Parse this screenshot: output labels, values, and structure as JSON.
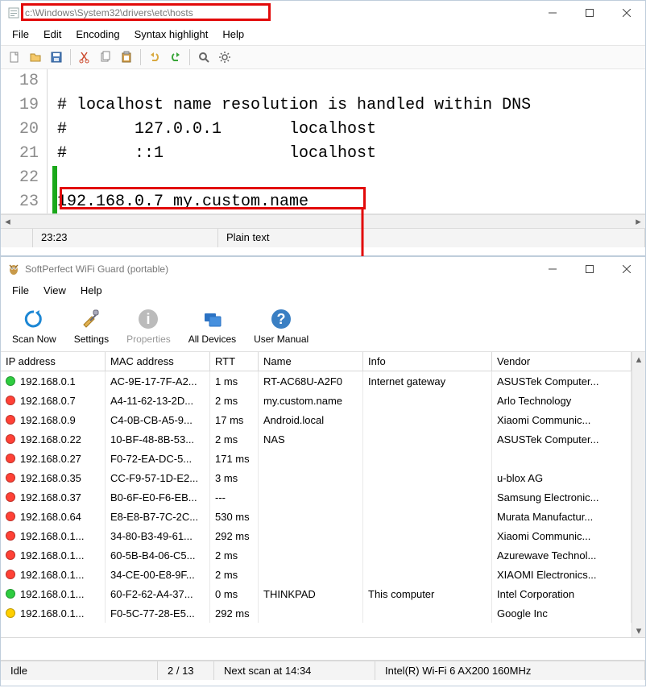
{
  "notepad": {
    "title": "c:\\Windows\\System32\\drivers\\etc\\hosts",
    "menu": [
      "File",
      "Edit",
      "Encoding",
      "Syntax highlight",
      "Help"
    ],
    "lines": [
      {
        "n": "18",
        "text": ""
      },
      {
        "n": "19",
        "text": "# localhost name resolution is handled within DNS"
      },
      {
        "n": "20",
        "text": "#       127.0.0.1       localhost"
      },
      {
        "n": "21",
        "text": "#       ::1             localhost"
      },
      {
        "n": "22",
        "text": ""
      },
      {
        "n": "23",
        "text": "192.168.0.7 my.custom.name"
      }
    ],
    "status": {
      "pos": "23:23",
      "mode": "Plain text"
    }
  },
  "wifiguard": {
    "title": "SoftPerfect WiFi Guard (portable)",
    "menu": [
      "File",
      "View",
      "Help"
    ],
    "toolbar": [
      "Scan Now",
      "Settings",
      "Properties",
      "All Devices",
      "User Manual"
    ],
    "columns": [
      "IP address",
      "MAC address",
      "RTT",
      "Name",
      "Info",
      "Vendor"
    ],
    "rows": [
      {
        "dot": "green",
        "ip": "192.168.0.1",
        "mac": "AC-9E-17-7F-A2...",
        "rtt": "1 ms",
        "name": "RT-AC68U-A2F0",
        "info": "Internet gateway",
        "vendor": "ASUSTek Computer..."
      },
      {
        "dot": "red",
        "ip": "192.168.0.7",
        "mac": "A4-11-62-13-2D...",
        "rtt": "2 ms",
        "name": "my.custom.name",
        "info": "",
        "vendor": "Arlo Technology"
      },
      {
        "dot": "red",
        "ip": "192.168.0.9",
        "mac": "C4-0B-CB-A5-9...",
        "rtt": "17 ms",
        "name": "Android.local",
        "info": "",
        "vendor": "Xiaomi Communic..."
      },
      {
        "dot": "red",
        "ip": "192.168.0.22",
        "mac": "10-BF-48-8B-53...",
        "rtt": "2 ms",
        "name": "NAS",
        "info": "",
        "vendor": "ASUSTek Computer..."
      },
      {
        "dot": "red",
        "ip": "192.168.0.27",
        "mac": "F0-72-EA-DC-5...",
        "rtt": "171 ms",
        "name": "",
        "info": "",
        "vendor": ""
      },
      {
        "dot": "red",
        "ip": "192.168.0.35",
        "mac": "CC-F9-57-1D-E2...",
        "rtt": "3 ms",
        "name": "",
        "info": "",
        "vendor": "u-blox AG"
      },
      {
        "dot": "red",
        "ip": "192.168.0.37",
        "mac": "B0-6F-E0-F6-EB...",
        "rtt": "---",
        "name": "",
        "info": "",
        "vendor": "Samsung Electronic..."
      },
      {
        "dot": "red",
        "ip": "192.168.0.64",
        "mac": "E8-E8-B7-7C-2C...",
        "rtt": "530 ms",
        "name": "",
        "info": "",
        "vendor": "Murata Manufactur..."
      },
      {
        "dot": "red",
        "ip": "192.168.0.1...",
        "mac": "34-80-B3-49-61...",
        "rtt": "292 ms",
        "name": "",
        "info": "",
        "vendor": "Xiaomi Communic..."
      },
      {
        "dot": "red",
        "ip": "192.168.0.1...",
        "mac": "60-5B-B4-06-C5...",
        "rtt": "2 ms",
        "name": "",
        "info": "",
        "vendor": "Azurewave Technol..."
      },
      {
        "dot": "red",
        "ip": "192.168.0.1...",
        "mac": "34-CE-00-E8-9F...",
        "rtt": "2 ms",
        "name": "",
        "info": "",
        "vendor": "XIAOMI Electronics..."
      },
      {
        "dot": "green",
        "ip": "192.168.0.1...",
        "mac": "60-F2-62-A4-37...",
        "rtt": "0 ms",
        "name": "THINKPAD",
        "info": "This computer",
        "vendor": "Intel Corporation"
      },
      {
        "dot": "yellow",
        "ip": "192.168.0.1...",
        "mac": "F0-5C-77-28-E5...",
        "rtt": "292 ms",
        "name": "",
        "info": "",
        "vendor": "Google Inc"
      }
    ],
    "status": {
      "state": "Idle",
      "count": "2 / 13",
      "next": "Next scan at 14:34",
      "adapter": "Intel(R) Wi-Fi 6 AX200 160MHz"
    }
  }
}
